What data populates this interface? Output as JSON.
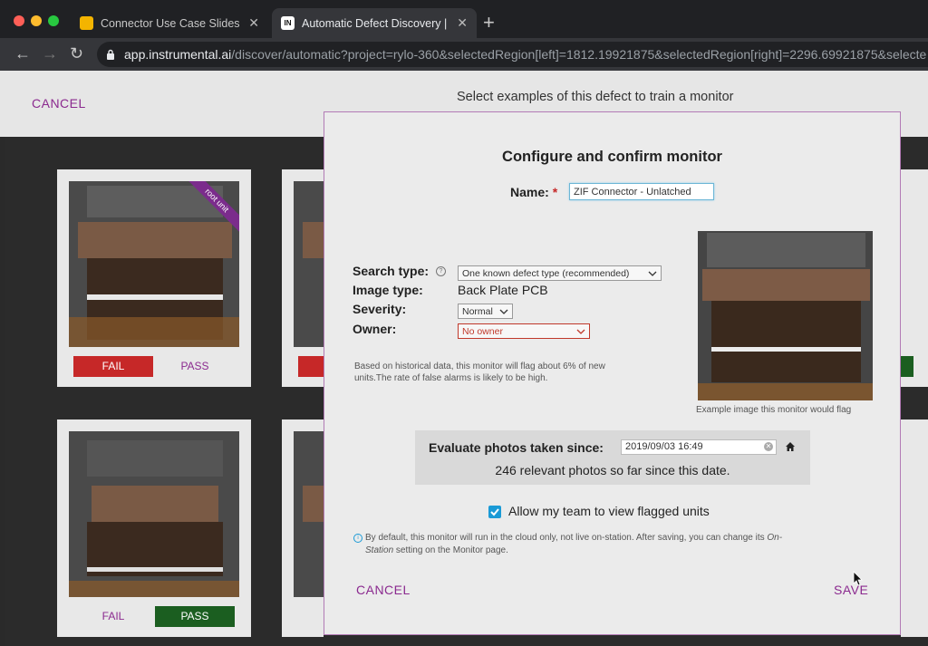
{
  "browser": {
    "tabs": [
      {
        "title": "Connector Use Case Slides - G",
        "favicon": "slides-icon",
        "active": false
      },
      {
        "title": "Automatic Defect Discovery | In",
        "favicon": "IN",
        "active": true
      }
    ],
    "url_host": "app.instrumental.ai",
    "url_path": "/discover/automatic?project=rylo-360&selectedRegion[left]=1812.19921875&selectedRegion[right]=2296.69921875&selecte"
  },
  "page": {
    "cancel_label": "CANCEL",
    "instruction": "Select examples of this defect to train a monitor",
    "cards": [
      {
        "fail_label": "FAIL",
        "pass_label": "PASS",
        "selected": "fail",
        "ribbon": "root unit"
      },
      {
        "fail_label": "FAIL",
        "pass_label": "PASS",
        "selected": "pass"
      }
    ]
  },
  "modal": {
    "title": "Configure and confirm monitor",
    "name_label": "Name:",
    "name_required_mark": "*",
    "name_value": "ZIF Connector - Unlatched",
    "search_type_label": "Search type:",
    "search_type_value": "One known defect type (recommended)",
    "image_type_label": "Image type:",
    "image_type_value": "Back Plate PCB",
    "severity_label": "Severity:",
    "severity_value": "Normal",
    "owner_label": "Owner:",
    "owner_value": "No owner",
    "historical_note": "Based on historical data, this monitor will flag about 6% of new units.The rate of false alarms is likely to be high.",
    "example_caption": "Example image this monitor would flag",
    "evaluate_label": "Evaluate photos taken since:",
    "evaluate_date": "2019/09/03 16:49",
    "relevant_photos": "246 relevant photos so far since this date.",
    "allow_team_label": "Allow my team to view flagged units",
    "allow_team_checked": true,
    "info_text_1": "By default, this monitor will run in the cloud only, not live on-station. After saving, you can change its ",
    "info_text_em": "On-Station",
    "info_text_2": " setting on the Monitor page.",
    "cancel_label": "CANCEL",
    "save_label": "SAVE"
  },
  "colors": {
    "accent_purple": "#8b2a8f",
    "fail_red": "#c62828",
    "pass_green": "#1b5e20",
    "checkbox_blue": "#1a9ad6"
  }
}
